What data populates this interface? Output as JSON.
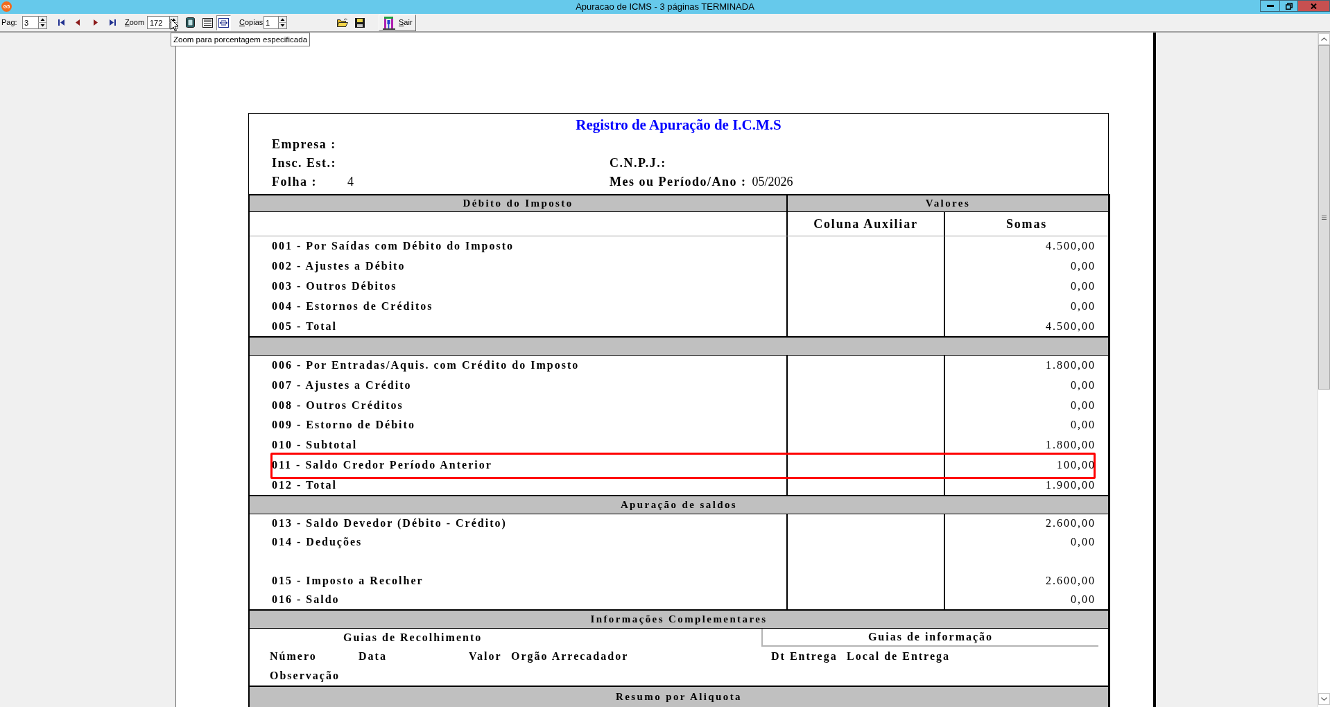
{
  "window": {
    "title": "Apuracao de ICMS - 3 páginas TERMINADA",
    "app_badge": "G5"
  },
  "toolbar": {
    "page_label": "Pag:",
    "page": "3",
    "zoom_label": "Zoom",
    "zoom": "172",
    "view_modes": [
      {
        "selected": false
      },
      {
        "selected": false
      },
      {
        "selected": true
      }
    ],
    "copies_label": "Copias",
    "copies": "1",
    "exit_button": "Sair"
  },
  "tooltip": "Zoom para porcentagem especificada",
  "report": {
    "title": "Registro de Apuração de I.C.M.S",
    "header_rows": [
      [
        {
          "label": "Empresa :"
        }
      ],
      [
        {
          "label": "Insc. Est.:"
        },
        {
          "label": "C.N.P.J.:"
        }
      ],
      [
        {
          "label": "Folha :",
          "value": "4"
        },
        {
          "label": "Mes ou Período/Ano :",
          "value": "05/2026"
        }
      ]
    ],
    "table": {
      "header": {
        "column_1": "Débito do Imposto",
        "column_2": "Valores"
      },
      "subheader": [
        "Coluna Auxiliar",
        "Somas"
      ],
      "sections": [
        {
          "rows": [
            {
              "label": "001 - Por Saídas com Débito do Imposto",
              "value": "4.500,00",
              "highlighted": false
            },
            {
              "label": "002 - Ajustes a Débito",
              "value": "0,00",
              "highlighted": false
            },
            {
              "label": "003 - Outros Débitos",
              "value": "0,00",
              "highlighted": false
            },
            {
              "label": "004 - Estornos de Créditos",
              "value": "0,00",
              "highlighted": false
            },
            {
              "label": "005 - Total",
              "value": "4.500,00",
              "highlighted": false
            }
          ]
        },
        {
          "rows": [
            {
              "label": "006 - Por Entradas/Aquis. com Crédito do Imposto",
              "value": "1.800,00",
              "highlighted": false
            },
            {
              "label": "007 - Ajustes a Crédito",
              "value": "0,00",
              "highlighted": false
            },
            {
              "label": "008 - Outros Créditos",
              "value": "0,00",
              "highlighted": false
            },
            {
              "label": "009 - Estorno de Débito",
              "value": "0,00",
              "highlighted": false
            },
            {
              "label": "010 - Subtotal",
              "value": "1.800,00",
              "highlighted": false
            },
            {
              "label": "011 - Saldo Credor Período Anterior",
              "value": "100,00",
              "highlighted": true
            },
            {
              "label": "012 - Total",
              "value": "1.900,00",
              "highlighted": false
            }
          ]
        },
        {
          "title": "Apuração de saldos",
          "rows": [
            {
              "label": "013 - Saldo Devedor (Débito - Crédito)",
              "value": "2.600,00",
              "highlighted": false
            },
            {
              "label": "014 - Deduções",
              "value": "0,00",
              "highlighted": false
            },
            {
              "label": "015 - Imposto a Recolher",
              "value": "2.600,00",
              "highlighted": false
            },
            {
              "label": "016 - Saldo",
              "value": "0,00",
              "highlighted": false
            }
          ]
        }
      ]
    },
    "complementary": {
      "title": "Informações Complementares",
      "left_title": "Guias de Recolhimento",
      "right_title": "Guias de informação",
      "left_columns": [
        "Número",
        "Data",
        "Valor",
        "Orgão Arrecadador"
      ],
      "right_columns": [
        "Dt Entrega",
        "Local de Entrega"
      ],
      "note_label": "Observação"
    },
    "next_section": {
      "title": "Resumo por Aliquota"
    }
  }
}
